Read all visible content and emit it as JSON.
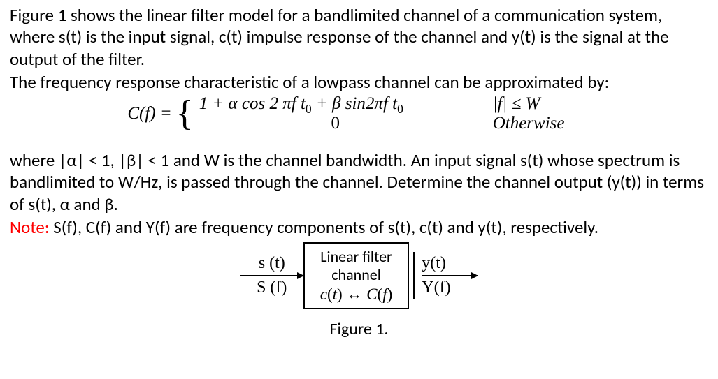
{
  "para1": "Figure 1 shows the linear filter model for a bandlimited channel of a communication system, where s(t) is the input signal, c(t) impulse response of the channel and y(t) is the signal at the output of the filter.",
  "para2": "The frequency response characteristic of a lowpass channel can be approximated by:",
  "eq": {
    "lhs": "C(f) = ",
    "case1_body": "1 + α cos 2 πf t",
    "case1_body_sub": "0",
    "case1_body_mid": " + β sin2πf t",
    "case1_body_sub2": "0",
    "case1_cond": "|f| ≤ W",
    "case2_body": "0",
    "case2_cond": "Otherwise"
  },
  "para3": "where |α| < 1, |β| < 1 and W is the channel bandwidth. An input signal s(t) whose spectrum is bandlimited to W/Hz, is passed through the channel. Determine the channel output (y(t)) in terms of s(t), α and β.",
  "note_label": "Note:",
  "note_text": " S(f), C(f) and Y(f) are frequency components of s(t), c(t) and y(t), respectively.",
  "diagram": {
    "in_top": "s (t)",
    "in_bot": "S (f)",
    "box_line1": "Linear filter",
    "box_line2": "channel",
    "box_line3": "c(t) ↔ C(f)",
    "out_top": "y(t)",
    "out_bot": "Y(f)"
  },
  "caption": "Figure 1."
}
